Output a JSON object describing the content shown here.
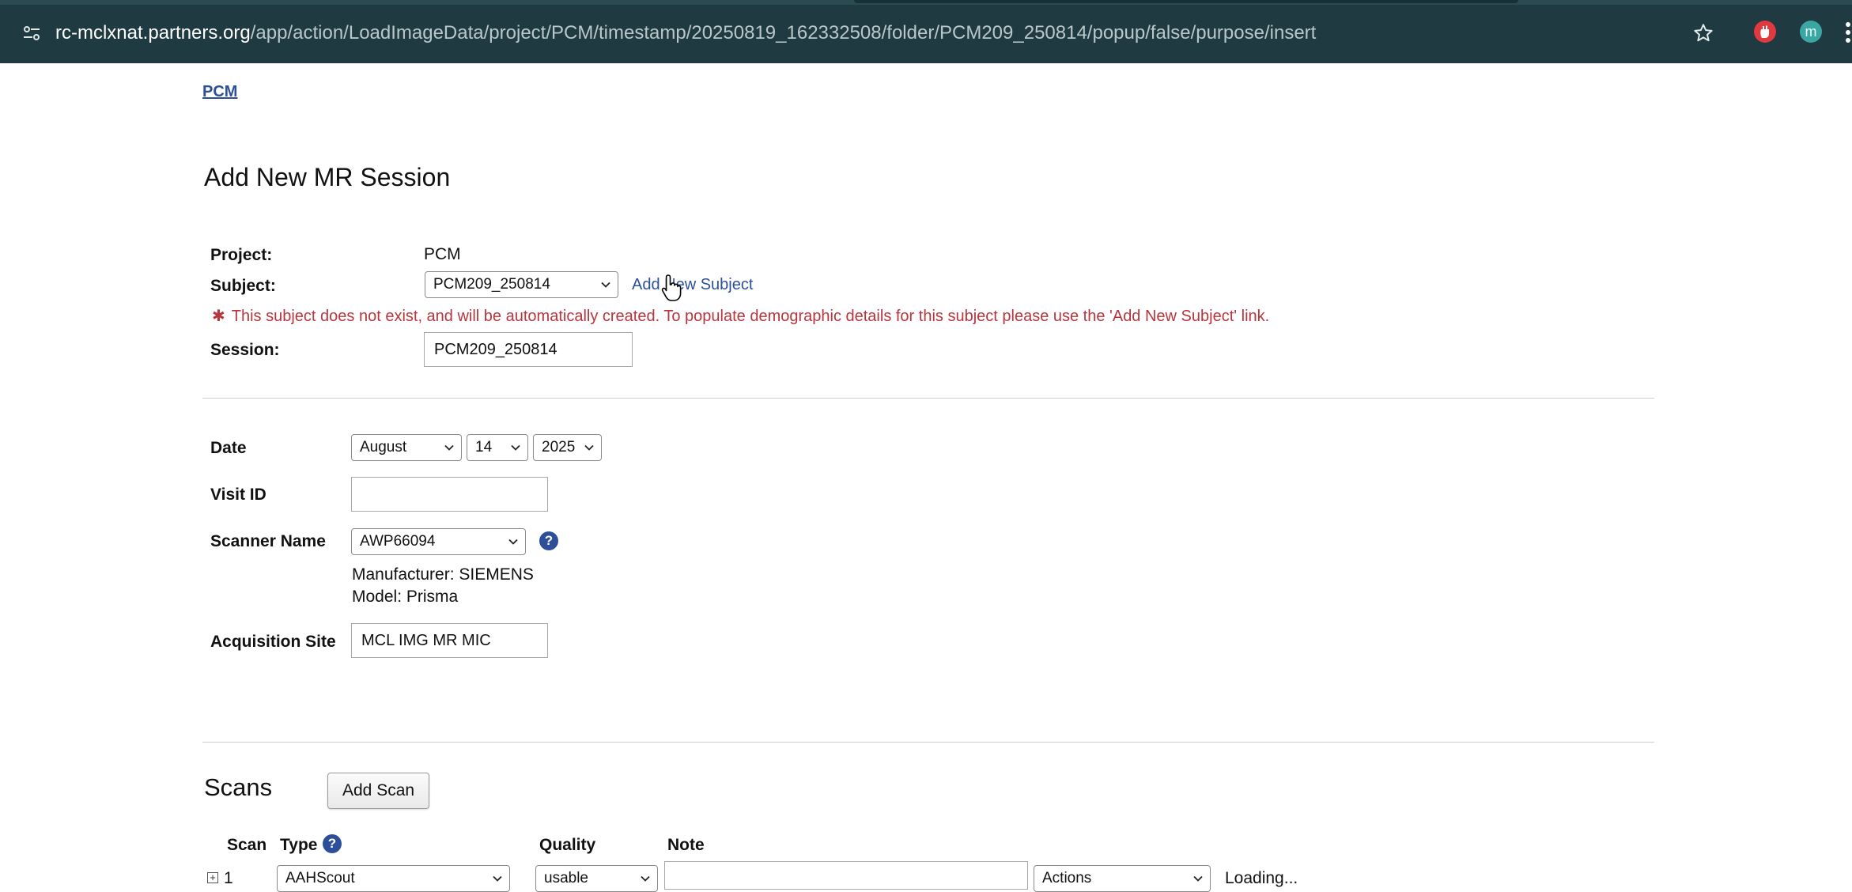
{
  "browser": {
    "url_host": "rc-mclxnat.partners.org",
    "url_path": "/app/action/LoadImageData/project/PCM/timestamp/20250819_162332508/folder/PCM209_250814/popup/false/purpose/insert",
    "profile_letter": "m"
  },
  "breadcrumb": {
    "project": "PCM"
  },
  "page": {
    "title": "Add New MR Session"
  },
  "form": {
    "project_label": "Project:",
    "project_value": "PCM",
    "subject_label": "Subject:",
    "subject_value": "PCM209_250814",
    "add_subject_link": "Add New Subject",
    "warning_marker": "✱",
    "warning_text": "This subject does not exist, and will be automatically created. To populate demographic details for this subject please use the 'Add New Subject' link.",
    "session_label": "Session:",
    "session_value": "PCM209_250814"
  },
  "details": {
    "date_label": "Date",
    "date_month": "August",
    "date_day": "14",
    "date_year": "2025",
    "visit_label": "Visit ID",
    "visit_value": "",
    "scanner_label": "Scanner Name",
    "scanner_value": "AWP66094",
    "manufacturer": "Manufacturer: SIEMENS",
    "model": "Model: Prisma",
    "site_label": "Acquisition Site",
    "site_value": "MCL IMG MR MIC"
  },
  "scans": {
    "title": "Scans",
    "add_button": "Add Scan",
    "columns": {
      "scan": "Scan",
      "type": "Type",
      "quality": "Quality",
      "note": "Note"
    },
    "rows": [
      {
        "number": "1",
        "type": "AAHScout",
        "quality": "usable",
        "note": "",
        "actions": "Actions",
        "status": "Loading..."
      }
    ]
  },
  "colors": {
    "chrome": "#1f3b41",
    "link": "#2d4e99",
    "warning": "#b8353d"
  },
  "icons": [
    "site-info-icon",
    "bookmark-star-icon",
    "extension-icon",
    "cursor-hand-icon",
    "help-icon",
    "chevron-down-icon",
    "expand-icon"
  ]
}
